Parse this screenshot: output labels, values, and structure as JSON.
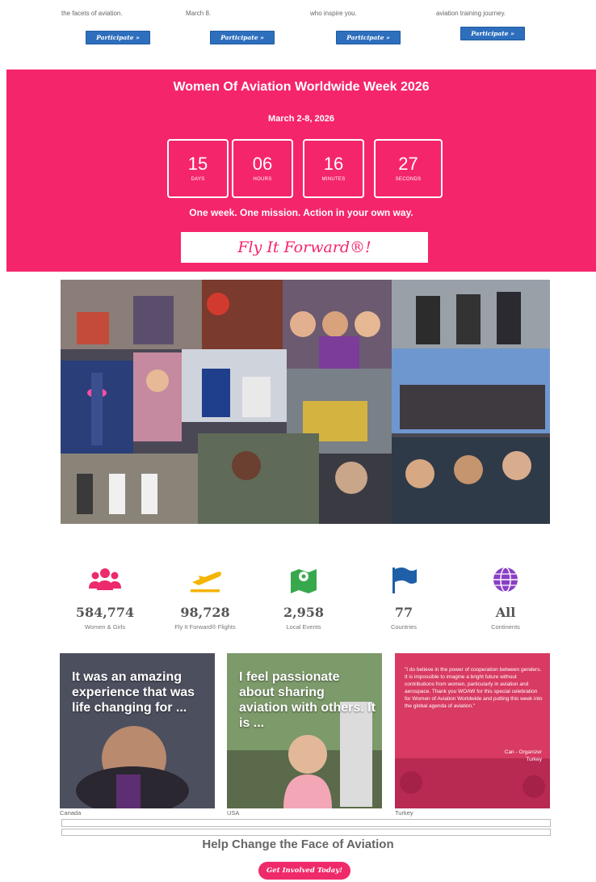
{
  "top_cards": [
    {
      "snippet": "the facets of aviation.",
      "button": "Participate »"
    },
    {
      "snippet": "March 8.",
      "button": "Participate »"
    },
    {
      "snippet": "who inspire you.",
      "button": "Participate »"
    },
    {
      "snippet": "aviation training journey.",
      "button": "Participate »"
    }
  ],
  "countdown": {
    "title": "Women Of Aviation Worldwide Week 2026",
    "dates": "March 2-8, 2026",
    "boxes": [
      {
        "value": "15",
        "unit": "DAYS"
      },
      {
        "value": "06",
        "unit": "HOURS"
      },
      {
        "value": "16",
        "unit": "MINUTES"
      },
      {
        "value": "27",
        "unit": "SECONDS"
      }
    ],
    "tagline": "One week. One mission. Action in your own way.",
    "cta": "Fly It Forward®!"
  },
  "stats": [
    {
      "icon": "users-icon",
      "value": "584,774",
      "label": "Women & Girls",
      "color": "#ec2a6d"
    },
    {
      "icon": "plane-takeoff-icon",
      "value": "98,728",
      "label": "Fly It Forward® Flights",
      "color": "#f5b400"
    },
    {
      "icon": "map-pin-icon",
      "value": "2,958",
      "label": "Local Events",
      "color": "#38a84d"
    },
    {
      "icon": "flag-icon",
      "value": "77",
      "label": "Countries",
      "color": "#1e5fa8"
    },
    {
      "icon": "globe-icon",
      "value": "All",
      "label": "Continents",
      "color": "#8a3fc4"
    }
  ],
  "testimonials": [
    {
      "quote": "It was an amazing experience that was life changing for ...",
      "country": "Canada"
    },
    {
      "quote": "I feel passionate about sharing aviation with others. It is ...",
      "country": "USA"
    },
    {
      "quote": "\"I do believe in the power of cooperation between genders. It is impossible to imagine a bright future without contributions from women, particularly in aviation and aerospace. Thank you WOAW for this special celebration for Women of Aviation Worldwide and putting this week into the global agenda of aviation.\"",
      "signature": "Can - Organizer",
      "signature_country": "Turkey",
      "country": "Turkey"
    }
  ],
  "footer": {
    "heading": "Help Change the Face of Aviation",
    "button": "Get Involved Today!"
  },
  "colors": {
    "pink": "#f5256b",
    "button_blue": "#2e6fbd"
  }
}
